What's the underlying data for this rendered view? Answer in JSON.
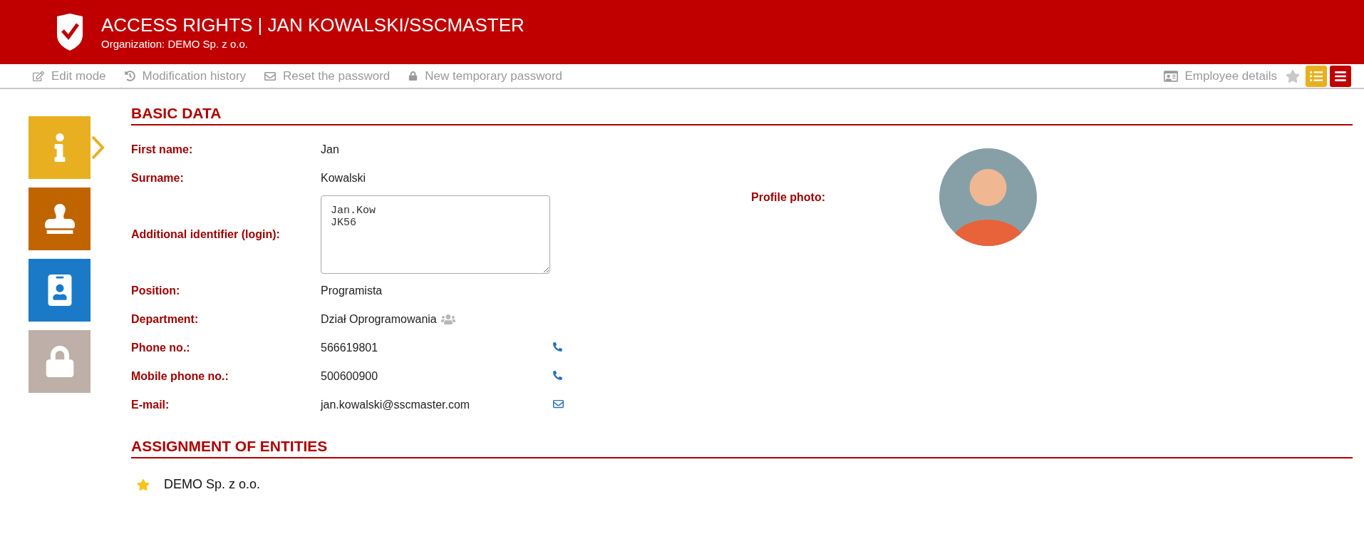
{
  "header": {
    "title": "ACCESS RIGHTS | JAN KOWALSKI/SSCMASTER",
    "organization": "Organization: DEMO Sp. z o.o."
  },
  "toolbar": {
    "actions": [
      {
        "kind": "edit",
        "label": "Edit mode"
      },
      {
        "kind": "history",
        "label": "Modification history"
      },
      {
        "kind": "mail",
        "label": "Reset the password"
      },
      {
        "kind": "lock",
        "label": "New temporary password"
      }
    ],
    "employee_details": "Employee details",
    "favorite": false
  },
  "sidebar": [
    {
      "kind": "info",
      "selected": true,
      "color": "#e8b020"
    },
    {
      "kind": "stamp",
      "selected": false,
      "color": "#c06400"
    },
    {
      "kind": "badge",
      "selected": false,
      "color": "#1a7ac8"
    },
    {
      "kind": "lock",
      "selected": false,
      "color": "#beb0a8"
    }
  ],
  "basic_data": {
    "title": "BASIC DATA",
    "fields": [
      {
        "kind": "text",
        "label": "First name:",
        "value": "Jan"
      },
      {
        "kind": "text",
        "label": "Surname:",
        "value": "Kowalski"
      },
      {
        "kind": "textarea",
        "label": "Additional identifier (login):",
        "value": "Jan.Kow\nJK56"
      },
      {
        "kind": "text",
        "label": "Position:",
        "value": "Programista"
      },
      {
        "kind": "group",
        "label": "Department:",
        "value": "Dział Oprogramowania"
      },
      {
        "kind": "phone",
        "label": "Phone no.:",
        "value": "566619801"
      },
      {
        "kind": "phone",
        "label": "Mobile phone no.:",
        "value": "500600900"
      },
      {
        "kind": "email",
        "label": "E-mail:",
        "value": "jan.kowalski@sscmaster.com"
      }
    ],
    "photo_label": "Profile photo:"
  },
  "entities": {
    "title": "ASSIGNMENT OF ENTITIES",
    "items": [
      {
        "name": "DEMO Sp. z o.o.",
        "main": true
      }
    ]
  }
}
